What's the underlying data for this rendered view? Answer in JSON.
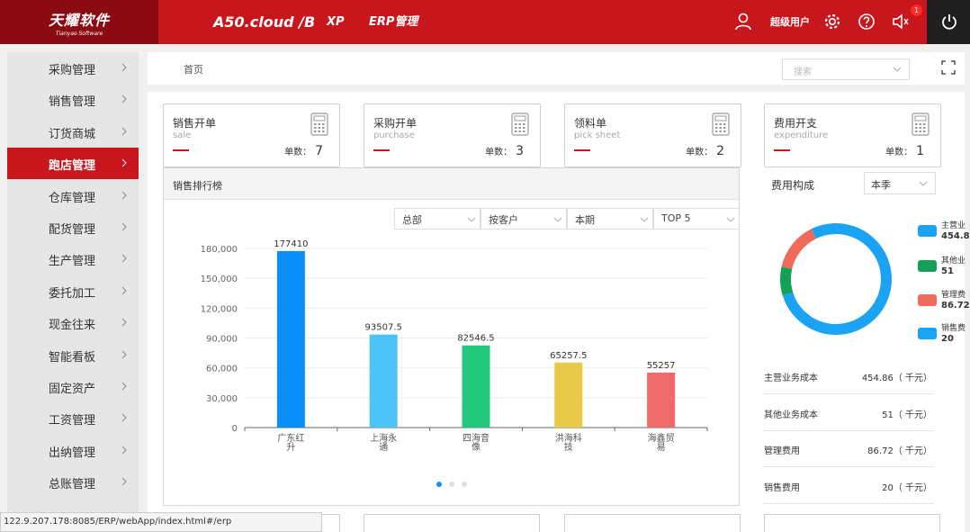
{
  "brand": {
    "name_cn": "天耀软件",
    "name_en": "Tianyao Software"
  },
  "top_nav": {
    "product": "A50.cloud /B",
    "xp": "XP",
    "erp": "ERP管理"
  },
  "user": {
    "name": "超级用户",
    "notification_count": "1"
  },
  "sidebar": {
    "items": [
      {
        "label": "采购管理"
      },
      {
        "label": "销售管理"
      },
      {
        "label": "订货商城"
      },
      {
        "label": "跑店管理"
      },
      {
        "label": "仓库管理"
      },
      {
        "label": "配货管理"
      },
      {
        "label": "生产管理"
      },
      {
        "label": "委托加工"
      },
      {
        "label": "现金往来"
      },
      {
        "label": "智能看板"
      },
      {
        "label": "固定资产"
      },
      {
        "label": "工资管理"
      },
      {
        "label": "出纳管理"
      },
      {
        "label": "总账管理"
      }
    ],
    "active_index": 3
  },
  "breadcrumb": {
    "home": "首页"
  },
  "search": {
    "placeholder": "搜索"
  },
  "cards": [
    {
      "title": "销售开单",
      "subtitle": "sale",
      "count_label": "单数：",
      "count": "7"
    },
    {
      "title": "采购开单",
      "subtitle": "purchase",
      "count_label": "单数：",
      "count": "3"
    },
    {
      "title": "领料单",
      "subtitle": "pick sheet",
      "count_label": "单数：",
      "count": "2"
    },
    {
      "title": "费用开支",
      "subtitle": "expenditure",
      "count_label": "单数：",
      "count": "1"
    }
  ],
  "ranking": {
    "title": "销售排行榜",
    "filters": [
      "总部",
      "按客户",
      "本期",
      "TOP 5"
    ]
  },
  "chart_data": {
    "type": "bar",
    "categories": [
      "广东红升",
      "上海永通",
      "四海音像",
      "洪海科技",
      "海鑫贸易"
    ],
    "category_lines": [
      [
        "广东红",
        "升"
      ],
      [
        "上海永",
        "通"
      ],
      [
        "四海音",
        "像"
      ],
      [
        "洪海科",
        "技"
      ],
      [
        "海鑫贸",
        "易"
      ]
    ],
    "values": [
      177410,
      93507.5,
      82546.5,
      65257.5,
      55257
    ],
    "value_labels": [
      "177410",
      "93507.5",
      "82546.5",
      "65257.5",
      "55257"
    ],
    "colors": [
      "#0a8ef7",
      "#4cc3f7",
      "#22c97d",
      "#e8c94a",
      "#ef6a6a"
    ],
    "yticks": [
      "0",
      "30,000",
      "60,000",
      "90,000",
      "120,000",
      "150,000",
      "180,000"
    ],
    "ylim": [
      0,
      180000
    ],
    "grid": true,
    "title": "",
    "xlabel": "",
    "ylabel": ""
  },
  "cost": {
    "title": "费用构成",
    "period": "本季",
    "unit": "（ 千元）",
    "legend": [
      {
        "name": "主营业",
        "value": "454.8",
        "color": "#1aa3f2"
      },
      {
        "name": "其他业",
        "value": "51",
        "color": "#12a155"
      },
      {
        "name": "管理费",
        "value": "86.72",
        "color": "#f06a5c"
      },
      {
        "name": "销售费",
        "value": "20",
        "color": "#1aa3f2"
      }
    ],
    "donut": [
      {
        "name": "主营业务成本",
        "value": 454.86,
        "color": "#1aa3f2"
      },
      {
        "name": "其他业务成本",
        "value": 51,
        "color": "#12a155"
      },
      {
        "name": "管理费用",
        "value": 86.72,
        "color": "#f06a5c"
      },
      {
        "name": "销售费用",
        "value": 20,
        "color": "#1aa3f2"
      }
    ],
    "rows": [
      {
        "name": "主营业务成本",
        "value": "454.86"
      },
      {
        "name": "其他业务成本",
        "value": "51"
      },
      {
        "name": "管理费用",
        "value": "86.72"
      },
      {
        "name": "销售费用",
        "value": "20"
      }
    ]
  },
  "status_url": "122.9.207.178:8085/ERP/webApp/index.html#/erp",
  "colors": {
    "brand_red": "#c8161d",
    "brand_dark": "#8b0b12"
  }
}
